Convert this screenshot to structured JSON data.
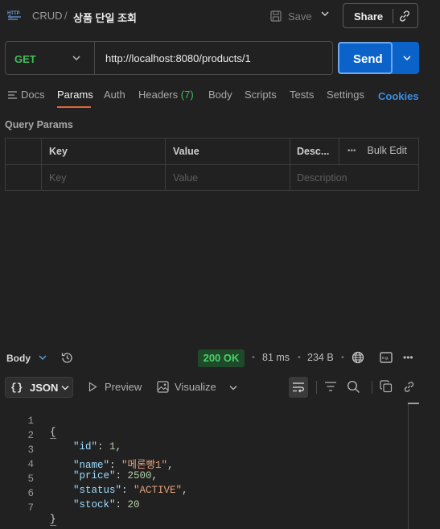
{
  "topbar": {
    "collection": "CRUD",
    "separator": "/",
    "request_title": "상품 단일 조회",
    "save_label": "Save",
    "share_label": "Share"
  },
  "request": {
    "method": "GET",
    "url": "http://localhost:8080/products/1",
    "send_label": "Send"
  },
  "tabs": {
    "docs": "Docs",
    "params": "Params",
    "auth": "Auth",
    "headers": "Headers",
    "headers_count": "(7)",
    "body": "Body",
    "scripts": "Scripts",
    "tests": "Tests",
    "settings": "Settings",
    "cookies": "Cookies",
    "active": "Params"
  },
  "query_params": {
    "title": "Query Params",
    "columns": [
      "Key",
      "Value",
      "Desc..."
    ],
    "bulk_edit": "Bulk Edit",
    "row_placeholders": [
      "Key",
      "Value",
      "Description"
    ]
  },
  "response": {
    "body_label": "Body",
    "status": "200 OK",
    "time": "81 ms",
    "size": "234 B",
    "format": "JSON",
    "preview_label": "Preview",
    "visualize_label": "Visualize",
    "lines": [
      {
        "n": "1",
        "text": "{"
      },
      {
        "n": "2",
        "key": "\"id\"",
        "val": "1",
        "type": "num"
      },
      {
        "n": "3",
        "key": "\"name\"",
        "val": "\"메론빵1\"",
        "type": "str"
      },
      {
        "n": "4",
        "key": "\"price\"",
        "val": "2500",
        "type": "num"
      },
      {
        "n": "5",
        "key": "\"status\"",
        "val": "\"ACTIVE\"",
        "type": "str"
      },
      {
        "n": "6",
        "key": "\"stock\"",
        "val": "20",
        "type": "num",
        "last": true
      },
      {
        "n": "7",
        "text": "}"
      }
    ]
  },
  "colors": {
    "background": "#212121",
    "method_get": "#3fbf5a",
    "send_button": "#0b63c9",
    "active_tab_underline": "#e0643a",
    "cookies_link": "#3a8ee6",
    "status_ok": "#4cd06a"
  }
}
